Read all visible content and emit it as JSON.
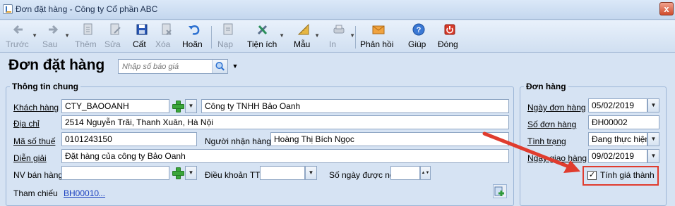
{
  "window": {
    "title": "Đơn đặt hàng - Công ty Cổ phần ABC",
    "close_label": "x"
  },
  "toolbar": {
    "back": "Trước",
    "forward": "Sau",
    "add": "Thêm",
    "edit": "Sửa",
    "save": "Cất",
    "delete": "Xóa",
    "undo": "Hoãn",
    "load": "Nạp",
    "utilities": "Tiện ích",
    "template": "Mẫu",
    "print": "In",
    "feedback": "Phản hồi",
    "help": "Giúp",
    "close": "Đóng"
  },
  "page": {
    "title": "Đơn đặt hàng",
    "quote_placeholder": "Nhập số báo giá"
  },
  "general": {
    "title": "Thông tin chung",
    "customer_label": "Khách hàng",
    "customer_code": "CTY_BAOOANH",
    "customer_name": "Công ty TNHH Bảo Oanh",
    "address_label": "Địa chỉ",
    "address": "2514 Nguyễn Trãi, Thanh Xuân, Hà Nội",
    "tax_label": "Mã số thuế",
    "tax": "0101243150",
    "receiver_label": "Người nhận hàng",
    "receiver": "Hoàng Thị Bích Ngọc",
    "desc_label": "Diễn giải",
    "desc": "Đặt hàng của công ty Bảo Oanh",
    "sales_label": "NV bán hàng",
    "sales": "",
    "terms_label": "Điều khoản TT",
    "terms": "",
    "debt_days_label": "Số ngày được nợ",
    "debt_days": "",
    "ref_label": "Tham chiếu",
    "ref_value": "BH00010",
    "ref_more": "..."
  },
  "order": {
    "title": "Đơn hàng",
    "date_label": "Ngày đơn hàng",
    "date": "05/02/2019",
    "number_label": "Số đơn hàng",
    "number": "ĐH00002",
    "status_label": "Tình trạng",
    "status": "Đang thực hiện",
    "delivery_label": "Ngày giao hàng",
    "delivery": "09/02/2019",
    "costing_label": "Tính giá thành",
    "costing_checked": "✓"
  },
  "colors": {
    "accent_red": "#e03c2e",
    "link": "#1a3fbf",
    "panel": "#d6e3f3"
  }
}
